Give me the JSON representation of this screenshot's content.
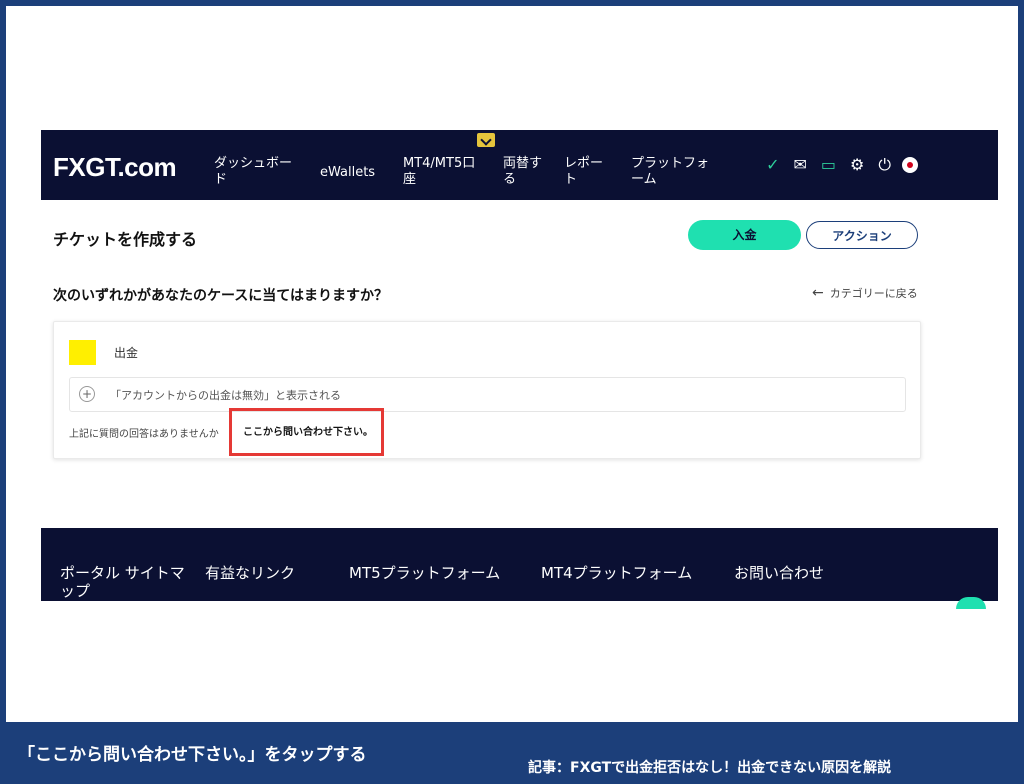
{
  "nav": {
    "logo": "FXGT.com",
    "items": [
      {
        "label": "ダッシュボー\nド"
      },
      {
        "label": "eWallets"
      },
      {
        "label": "MT4/MT5口\n座"
      },
      {
        "label": "両替す\nる"
      },
      {
        "label": "レポー\nト"
      },
      {
        "label": "プラットフォ\nーム"
      }
    ],
    "icons": [
      "check-circle-icon",
      "mail-icon",
      "ticket-icon",
      "gear-icon",
      "power-icon",
      "flag-japan-icon"
    ],
    "accent": "#1fe0b0",
    "background": "#0b1033"
  },
  "page": {
    "title": "チケットを作成する",
    "deposit_label": "入金",
    "action_label": "アクション",
    "question": "次のいずれかがあなたのケースに当てはまりますか？",
    "back_label": "カテゴリーに戻る"
  },
  "card": {
    "category": "出金",
    "faq_item": "「アカウントからの出金は無効」と表示される",
    "no_help_text": "上記に質問の回答はありませんか",
    "contact_link": "ここから問い合わせ下さい。"
  },
  "footer": {
    "columns": [
      "ポータル サイトマ\nップ",
      "有益なリンク",
      "MT5プラットフォーム",
      "MT4プラットフォーム",
      "お問い合わせ"
    ]
  },
  "caption": {
    "instruction": "「ここから問い合わせ下さい。」をタップする",
    "article": "記事：FXGTで出金拒否はなし！出金できない原因を解説"
  }
}
